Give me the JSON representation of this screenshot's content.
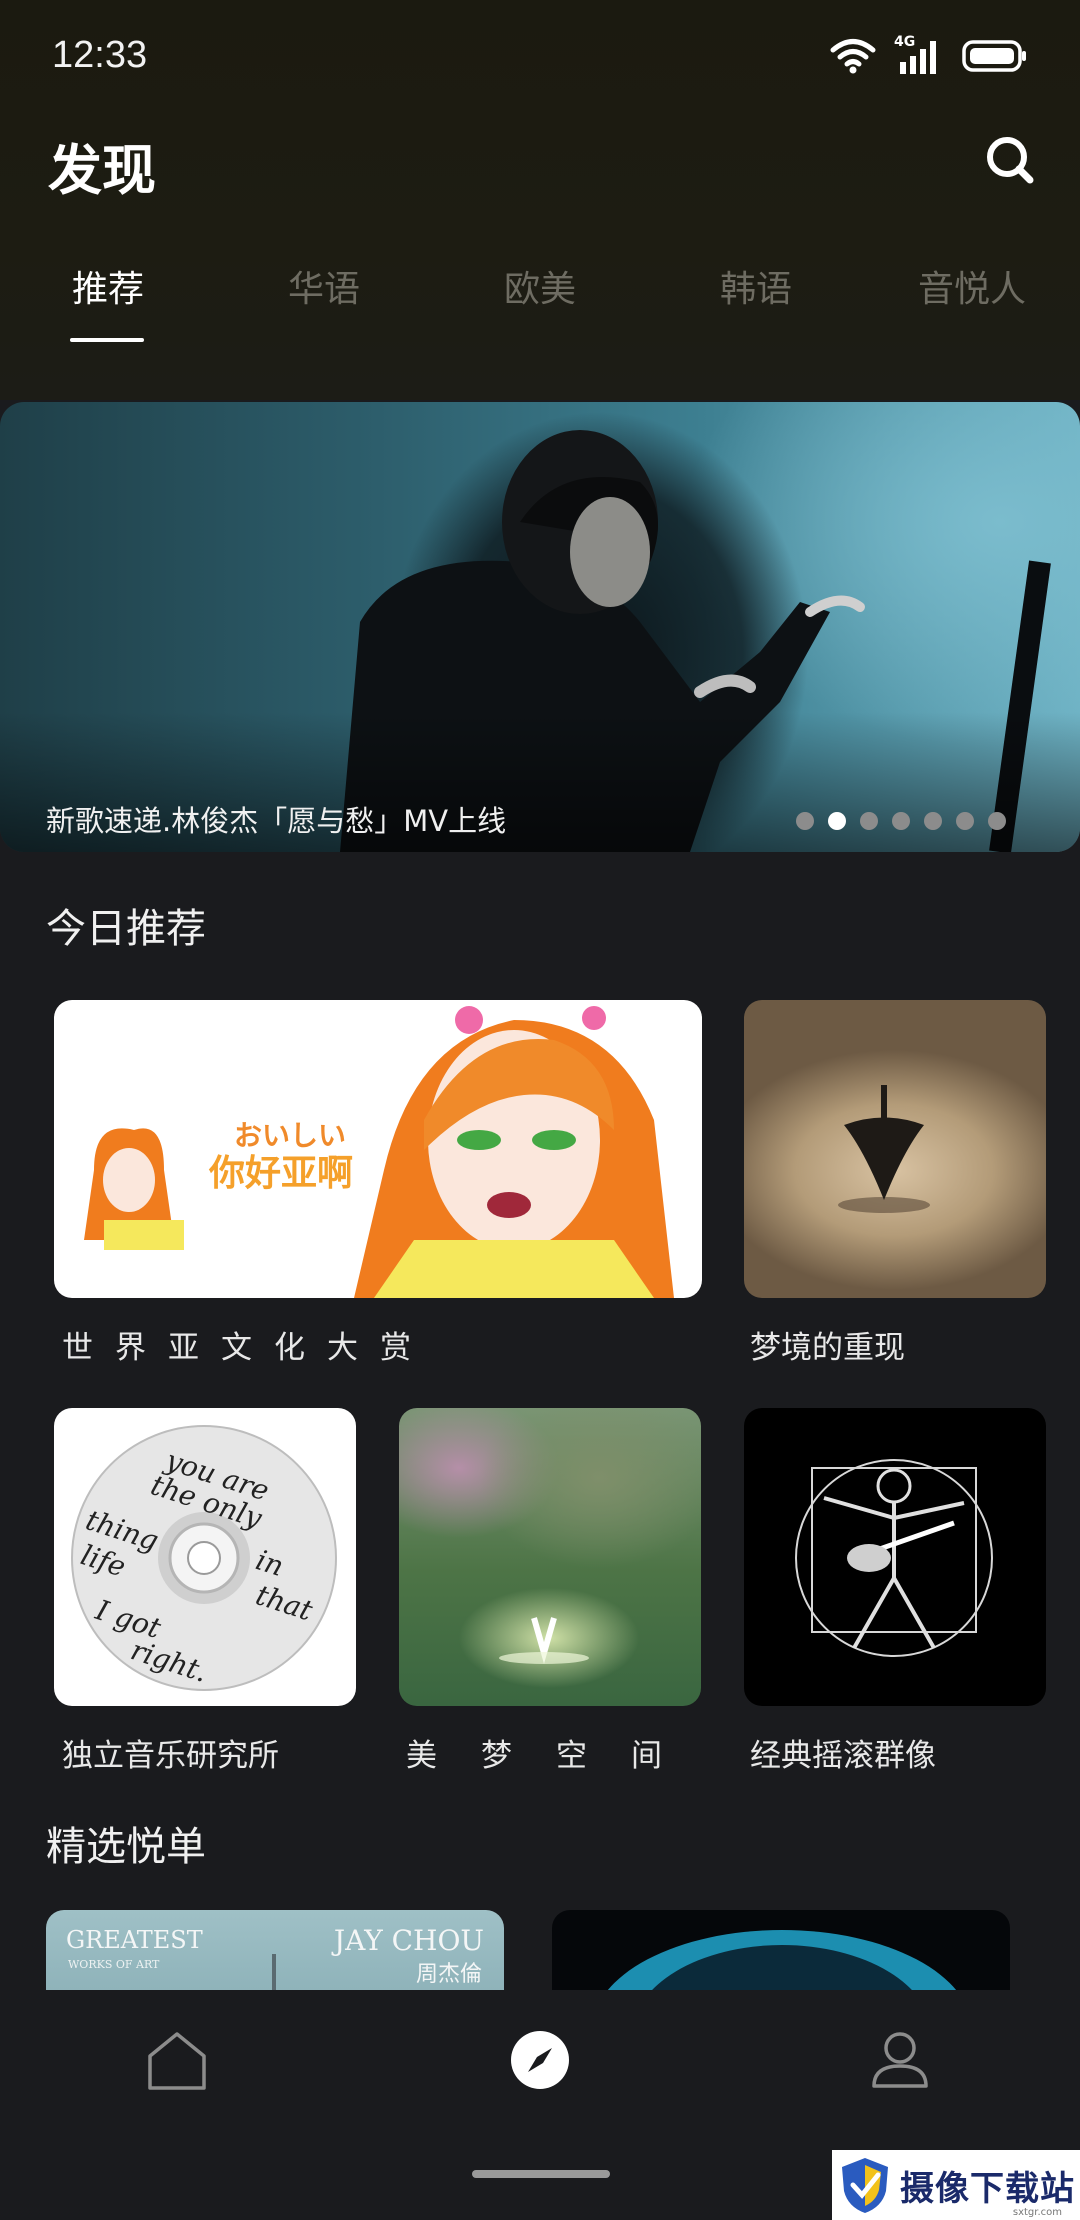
{
  "status_bar": {
    "time": "12:33",
    "network": "4G"
  },
  "header": {
    "title": "发现"
  },
  "tabs": [
    {
      "label": "推荐",
      "active": true
    },
    {
      "label": "华语",
      "active": false
    },
    {
      "label": "欧美",
      "active": false
    },
    {
      "label": "韩语",
      "active": false
    },
    {
      "label": "音悦人",
      "active": false
    }
  ],
  "banner": {
    "caption": "新歌速递.林俊杰「愿与愁」MV上线",
    "dot_count": 7,
    "active_dot": 1
  },
  "today": {
    "title": "今日推荐",
    "cards": [
      {
        "label": "世界亚文化大赏",
        "art_text": "おいしい 你好亚啊"
      },
      {
        "label": "梦境的重现"
      },
      {
        "label": "独立音乐研究所",
        "art_text": "you are the only thing in life that I got right."
      },
      {
        "label": "美梦空间"
      },
      {
        "label": "经典摇滚群像"
      }
    ]
  },
  "featured": {
    "title": "精选悦单",
    "cards": [
      {
        "art_left": "GREATEST",
        "art_left_sub": "WORKS OF ART",
        "art_right": "JAY CHOU",
        "art_right_sub": "周杰倫"
      },
      {
        "art": ""
      }
    ]
  },
  "bottom_nav": [
    {
      "icon": "home-icon"
    },
    {
      "icon": "compass-icon",
      "active": true
    },
    {
      "icon": "profile-icon"
    }
  ],
  "watermark": {
    "text": "摄像下载站",
    "url": "sxtgr.com"
  }
}
